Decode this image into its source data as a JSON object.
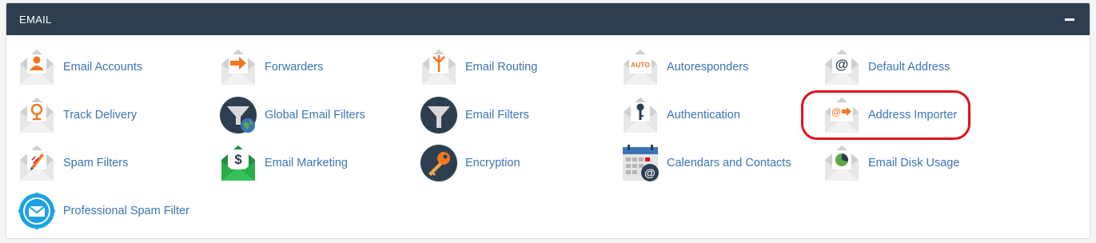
{
  "panel": {
    "title": "EMAIL",
    "collapse_icon": "minus-icon"
  },
  "colors": {
    "header_bg": "#2d3e50",
    "link": "#3d74b3",
    "envelope": "#dcdcdc",
    "accent_orange": "#f47521",
    "navy": "#2d3e50",
    "highlight": "#e0121a"
  },
  "items": [
    {
      "label": "Email Accounts",
      "icon": "email-accounts-icon"
    },
    {
      "label": "Forwarders",
      "icon": "forwarders-icon"
    },
    {
      "label": "Email Routing",
      "icon": "email-routing-icon"
    },
    {
      "label": "Autoresponders",
      "icon": "autoresponders-icon",
      "icon_text": "AUTO"
    },
    {
      "label": "Default Address",
      "icon": "default-address-icon",
      "icon_text": "@"
    },
    {
      "label": "Track Delivery",
      "icon": "track-delivery-icon"
    },
    {
      "label": "Global Email Filters",
      "icon": "global-email-filters-icon"
    },
    {
      "label": "Email Filters",
      "icon": "email-filters-icon"
    },
    {
      "label": "Authentication",
      "icon": "authentication-icon"
    },
    {
      "label": "Address Importer",
      "icon": "address-importer-icon",
      "icon_text": "@"
    },
    {
      "label": "Spam Filters",
      "icon": "spam-filters-icon"
    },
    {
      "label": "Email Marketing",
      "icon": "email-marketing-icon",
      "icon_text": "$"
    },
    {
      "label": "Encryption",
      "icon": "encryption-icon"
    },
    {
      "label": "Calendars and Contacts",
      "icon": "calendars-and-contacts-icon",
      "icon_text": "@"
    },
    {
      "label": "Email Disk Usage",
      "icon": "email-disk-usage-icon"
    },
    {
      "label": "Professional Spam Filter",
      "icon": "professional-spam-filter-icon"
    }
  ]
}
